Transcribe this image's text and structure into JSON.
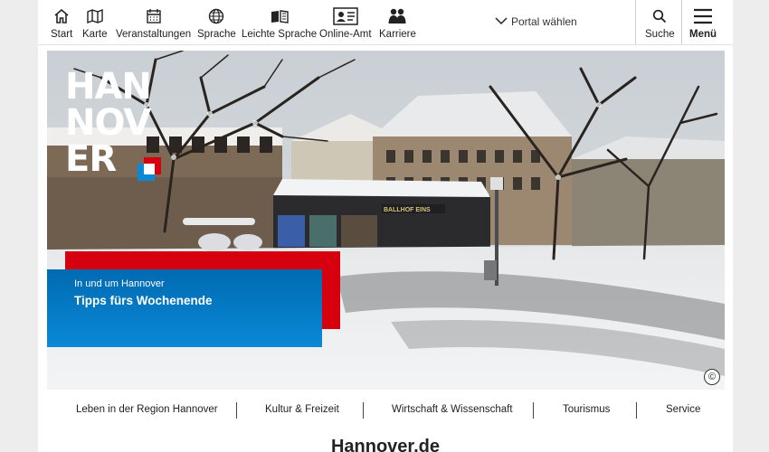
{
  "topnav": {
    "items": [
      {
        "label": "Start",
        "icon": "home-icon"
      },
      {
        "label": "Karte",
        "icon": "map-icon"
      },
      {
        "label": "Veranstaltungen",
        "icon": "calendar-icon"
      },
      {
        "label": "Sprache",
        "icon": "globe-icon"
      },
      {
        "label": "Leichte Sprache",
        "icon": "book-icon"
      },
      {
        "label": "Online-Amt",
        "icon": "id-card-icon"
      },
      {
        "label": "Karriere",
        "icon": "people-icon"
      }
    ],
    "portal_label": "Portal wählen",
    "search_label": "Suche",
    "menu_label": "Menü"
  },
  "hero": {
    "logo": [
      "HAN",
      "NOV",
      "ER"
    ],
    "teaser_kicker": "In und um Hannover",
    "teaser_title": "Tipps fürs Wochenende",
    "copyright_symbol": "©",
    "sign_text": "BALLHOF EINS"
  },
  "subnav": {
    "items": [
      "Leben in der Region Hannover",
      "Kultur & Freizeit",
      "Wirtschaft & Wissenschaft",
      "Tourismus",
      "Service"
    ]
  },
  "page": {
    "title": "Hannover.de"
  },
  "colors": {
    "red": "#d7000f",
    "blue": "#006ab2",
    "light_blue": "#0a89d6"
  }
}
